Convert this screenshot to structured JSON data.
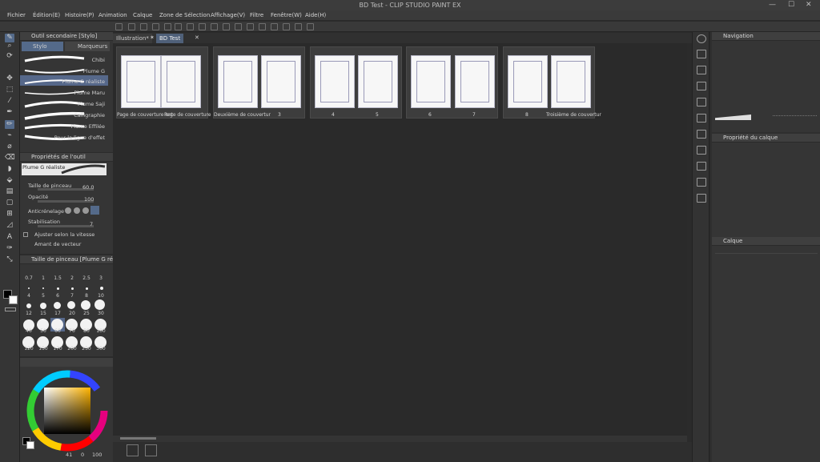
{
  "title_bar": {
    "title": "BD Test - CLIP STUDIO PAINT EX",
    "minimize": "—",
    "maximize": "☐",
    "close": "✕"
  },
  "menu": [
    "Fichier",
    "Édition(E)",
    "Histoire(P)",
    "Animation",
    "Calque",
    "Zone de Sélection",
    "Affichage(V)",
    "Filtre",
    "Fenêtre(W)",
    "Aide(H)"
  ],
  "tools": [
    {
      "icon": "pen-icon",
      "glyph": "✎"
    },
    {
      "icon": "zoom-icon",
      "glyph": "⌕"
    },
    {
      "icon": "rotate-icon",
      "glyph": "⟳"
    },
    {
      "icon": "move-icon",
      "glyph": "✥"
    },
    {
      "icon": "operation-icon",
      "glyph": "⬚"
    },
    {
      "icon": "eyedropper-icon",
      "glyph": "⁄"
    },
    {
      "icon": "pen-icon",
      "glyph": "✒"
    },
    {
      "icon": "pencil-icon",
      "glyph": "✏"
    },
    {
      "icon": "brush-icon",
      "glyph": "⌁"
    },
    {
      "icon": "airbrush-icon",
      "glyph": "⌀"
    },
    {
      "icon": "eraser-icon",
      "glyph": "⌫"
    },
    {
      "icon": "blend-icon",
      "glyph": "◗"
    },
    {
      "icon": "fill-icon",
      "glyph": "⬙"
    },
    {
      "icon": "gradient-icon",
      "glyph": "▤"
    },
    {
      "icon": "figure-icon",
      "glyph": "▢"
    },
    {
      "icon": "frame-icon",
      "glyph": "⊞"
    },
    {
      "icon": "ruler-icon",
      "glyph": "◿"
    },
    {
      "icon": "text-icon",
      "glyph": "A"
    },
    {
      "icon": "balloon-icon",
      "glyph": "✑"
    },
    {
      "icon": "correct-line-icon",
      "glyph": "⤡"
    }
  ],
  "subtool": {
    "header": "Outil secondaire [Stylo]",
    "tabs": [
      "Stylo",
      "Marqueurs"
    ],
    "items": [
      "Chibi",
      "Plume G",
      "Plume G réaliste",
      "Plume Maru",
      "Plume Saji",
      "Calligraphie",
      "Plume Effilée",
      "Pour la ligne d'effet"
    ]
  },
  "tool_props": {
    "header": "Propriétés de l'outil",
    "preview_label": "Plume G réaliste",
    "brush_size_label": "Taille de pinceau",
    "brush_size_value": "60.0",
    "opacity_label": "Opacité",
    "opacity_value": "100",
    "antialias_label": "Anticrénelage",
    "stabilization_label": "Stabilisation",
    "stabilization_value": "7",
    "option1": "Ajuster selon la vitesse",
    "option2": "Amant de vecteur"
  },
  "brush_size": {
    "header": "Taille de pinceau [Plume G ré",
    "rows": [
      [
        "",
        "",
        "",
        "",
        "",
        ""
      ],
      [
        "0.7",
        "1",
        "1.5",
        "2",
        "2.5",
        "3"
      ],
      [
        "4",
        "5",
        "6",
        "7",
        "8",
        "10"
      ],
      [
        "12",
        "15",
        "17",
        "20",
        "25",
        "30"
      ],
      [
        "40",
        "50",
        "60",
        "70",
        "80",
        "100"
      ],
      [
        "120",
        "150",
        "170",
        "200",
        "250",
        "300"
      ]
    ],
    "selected": "60"
  },
  "color": {
    "hue_hex": "#ffb400",
    "values": [
      "41",
      "0",
      "100"
    ]
  },
  "doc_tabs": [
    "Illustration*",
    "BD Test"
  ],
  "pages": [
    {
      "labels": [
        "Page de couverture ant",
        "Page de couverture"
      ]
    },
    {
      "labels": [
        "Deuxième de couvertur",
        "3"
      ]
    },
    {
      "labels": [
        "4",
        "5"
      ]
    },
    {
      "labels": [
        "6",
        "7"
      ]
    },
    {
      "labels": [
        "8",
        "Troisième de couvertur"
      ]
    }
  ],
  "navigation": {
    "header": "Navigation"
  },
  "layer_props": {
    "header": "Propriété du calque"
  },
  "layers": {
    "header": "Calque"
  }
}
